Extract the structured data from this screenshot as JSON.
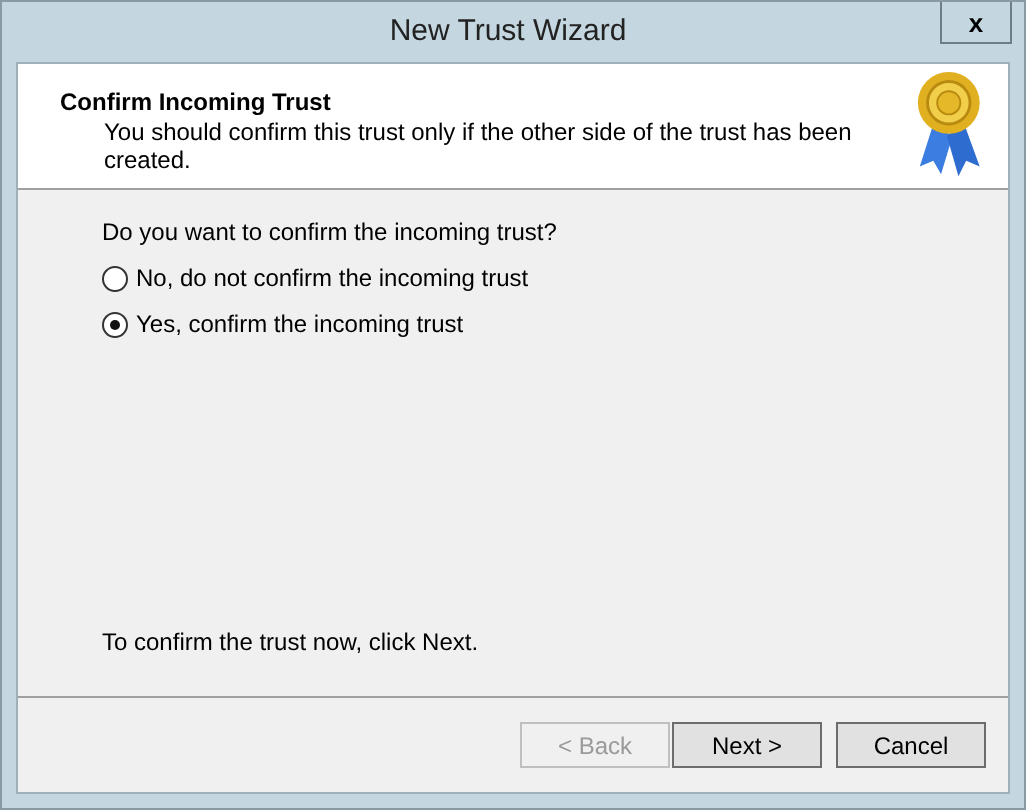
{
  "window": {
    "title": "New Trust Wizard",
    "close": "x"
  },
  "header": {
    "title": "Confirm Incoming Trust",
    "subtitle": "You should confirm this trust only if the other side of the trust has been created."
  },
  "question": "Do you want to confirm the incoming trust?",
  "options": [
    {
      "label": "No, do not confirm the incoming trust",
      "selected": false
    },
    {
      "label": "Yes, confirm the incoming trust",
      "selected": true
    }
  ],
  "hint": "To confirm the trust now, click Next.",
  "buttons": [
    {
      "label": "< Back",
      "disabled": true
    },
    {
      "label": "Next >",
      "disabled": false
    },
    {
      "label": "Cancel",
      "disabled": false
    }
  ]
}
